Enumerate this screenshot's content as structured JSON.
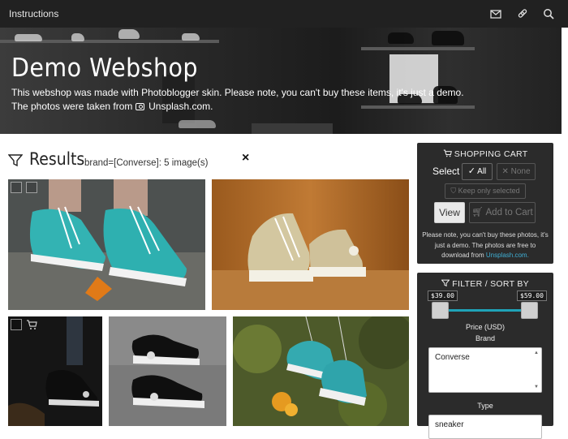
{
  "topbar": {
    "title": "Instructions",
    "icons": [
      "envelope-icon",
      "link-icon",
      "search-icon"
    ]
  },
  "hero": {
    "title": "Demo Webshop",
    "line1": "This webshop was made with Photoblogger skin. Please note, you can't buy these items, it's just a demo.",
    "line2_prefix": "The photos were taken from",
    "line2_link": "Unsplash.com."
  },
  "results": {
    "title": "Results",
    "filter_info": "brand=[Converse]: 5 image(s)",
    "close_label": "×"
  },
  "cart": {
    "title": "SHOPPING CART",
    "select_label": "Select",
    "all_label": "All",
    "none_label": "None",
    "keep_label": "Keep only selected",
    "view_label": "View",
    "add_label": "Add to Cart",
    "note_text": "Please note, you can't buy these photos, it's just a demo. The photos are free to download from",
    "note_link": "Unsplash.com."
  },
  "filter": {
    "title": "FILTER / SORT BY",
    "price_min": "$39.00",
    "price_max": "$59.00",
    "price_label": "Price (USD)",
    "brand_label": "Brand",
    "brand_value": "Converse",
    "type_label": "Type",
    "type_value": "sneaker"
  },
  "colors": {
    "topbar": "#212121",
    "panel": "#2b2b2b",
    "link": "#3fb0d6",
    "slider_track": "#1fa3b8"
  }
}
